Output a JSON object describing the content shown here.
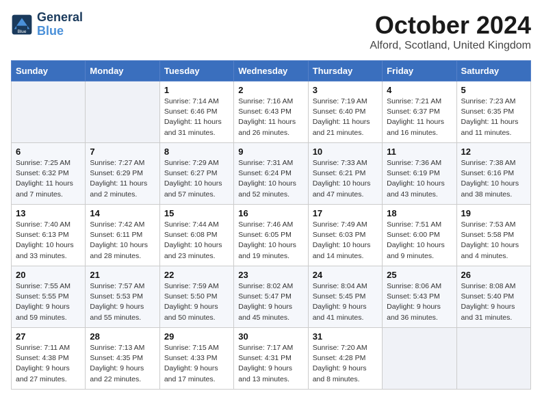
{
  "header": {
    "logo_line1": "General",
    "logo_line2": "Blue",
    "month": "October 2024",
    "location": "Alford, Scotland, United Kingdom"
  },
  "days_of_week": [
    "Sunday",
    "Monday",
    "Tuesday",
    "Wednesday",
    "Thursday",
    "Friday",
    "Saturday"
  ],
  "weeks": [
    [
      {
        "day": "",
        "info": ""
      },
      {
        "day": "",
        "info": ""
      },
      {
        "day": "1",
        "info": "Sunrise: 7:14 AM\nSunset: 6:46 PM\nDaylight: 11 hours and 31 minutes."
      },
      {
        "day": "2",
        "info": "Sunrise: 7:16 AM\nSunset: 6:43 PM\nDaylight: 11 hours and 26 minutes."
      },
      {
        "day": "3",
        "info": "Sunrise: 7:19 AM\nSunset: 6:40 PM\nDaylight: 11 hours and 21 minutes."
      },
      {
        "day": "4",
        "info": "Sunrise: 7:21 AM\nSunset: 6:37 PM\nDaylight: 11 hours and 16 minutes."
      },
      {
        "day": "5",
        "info": "Sunrise: 7:23 AM\nSunset: 6:35 PM\nDaylight: 11 hours and 11 minutes."
      }
    ],
    [
      {
        "day": "6",
        "info": "Sunrise: 7:25 AM\nSunset: 6:32 PM\nDaylight: 11 hours and 7 minutes."
      },
      {
        "day": "7",
        "info": "Sunrise: 7:27 AM\nSunset: 6:29 PM\nDaylight: 11 hours and 2 minutes."
      },
      {
        "day": "8",
        "info": "Sunrise: 7:29 AM\nSunset: 6:27 PM\nDaylight: 10 hours and 57 minutes."
      },
      {
        "day": "9",
        "info": "Sunrise: 7:31 AM\nSunset: 6:24 PM\nDaylight: 10 hours and 52 minutes."
      },
      {
        "day": "10",
        "info": "Sunrise: 7:33 AM\nSunset: 6:21 PM\nDaylight: 10 hours and 47 minutes."
      },
      {
        "day": "11",
        "info": "Sunrise: 7:36 AM\nSunset: 6:19 PM\nDaylight: 10 hours and 43 minutes."
      },
      {
        "day": "12",
        "info": "Sunrise: 7:38 AM\nSunset: 6:16 PM\nDaylight: 10 hours and 38 minutes."
      }
    ],
    [
      {
        "day": "13",
        "info": "Sunrise: 7:40 AM\nSunset: 6:13 PM\nDaylight: 10 hours and 33 minutes."
      },
      {
        "day": "14",
        "info": "Sunrise: 7:42 AM\nSunset: 6:11 PM\nDaylight: 10 hours and 28 minutes."
      },
      {
        "day": "15",
        "info": "Sunrise: 7:44 AM\nSunset: 6:08 PM\nDaylight: 10 hours and 23 minutes."
      },
      {
        "day": "16",
        "info": "Sunrise: 7:46 AM\nSunset: 6:05 PM\nDaylight: 10 hours and 19 minutes."
      },
      {
        "day": "17",
        "info": "Sunrise: 7:49 AM\nSunset: 6:03 PM\nDaylight: 10 hours and 14 minutes."
      },
      {
        "day": "18",
        "info": "Sunrise: 7:51 AM\nSunset: 6:00 PM\nDaylight: 10 hours and 9 minutes."
      },
      {
        "day": "19",
        "info": "Sunrise: 7:53 AM\nSunset: 5:58 PM\nDaylight: 10 hours and 4 minutes."
      }
    ],
    [
      {
        "day": "20",
        "info": "Sunrise: 7:55 AM\nSunset: 5:55 PM\nDaylight: 9 hours and 59 minutes."
      },
      {
        "day": "21",
        "info": "Sunrise: 7:57 AM\nSunset: 5:53 PM\nDaylight: 9 hours and 55 minutes."
      },
      {
        "day": "22",
        "info": "Sunrise: 7:59 AM\nSunset: 5:50 PM\nDaylight: 9 hours and 50 minutes."
      },
      {
        "day": "23",
        "info": "Sunrise: 8:02 AM\nSunset: 5:47 PM\nDaylight: 9 hours and 45 minutes."
      },
      {
        "day": "24",
        "info": "Sunrise: 8:04 AM\nSunset: 5:45 PM\nDaylight: 9 hours and 41 minutes."
      },
      {
        "day": "25",
        "info": "Sunrise: 8:06 AM\nSunset: 5:43 PM\nDaylight: 9 hours and 36 minutes."
      },
      {
        "day": "26",
        "info": "Sunrise: 8:08 AM\nSunset: 5:40 PM\nDaylight: 9 hours and 31 minutes."
      }
    ],
    [
      {
        "day": "27",
        "info": "Sunrise: 7:11 AM\nSunset: 4:38 PM\nDaylight: 9 hours and 27 minutes."
      },
      {
        "day": "28",
        "info": "Sunrise: 7:13 AM\nSunset: 4:35 PM\nDaylight: 9 hours and 22 minutes."
      },
      {
        "day": "29",
        "info": "Sunrise: 7:15 AM\nSunset: 4:33 PM\nDaylight: 9 hours and 17 minutes."
      },
      {
        "day": "30",
        "info": "Sunrise: 7:17 AM\nSunset: 4:31 PM\nDaylight: 9 hours and 13 minutes."
      },
      {
        "day": "31",
        "info": "Sunrise: 7:20 AM\nSunset: 4:28 PM\nDaylight: 9 hours and 8 minutes."
      },
      {
        "day": "",
        "info": ""
      },
      {
        "day": "",
        "info": ""
      }
    ]
  ]
}
